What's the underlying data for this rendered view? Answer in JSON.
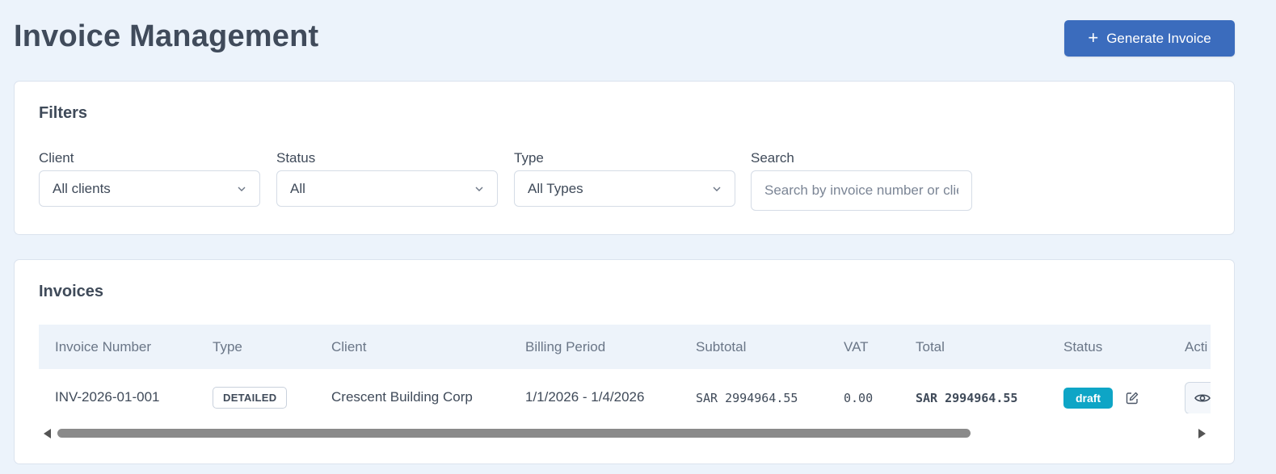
{
  "header": {
    "title": "Invoice Management",
    "generate_button": {
      "icon": "plus-icon",
      "label": "Generate Invoice"
    }
  },
  "filters": {
    "title": "Filters",
    "client": {
      "label": "Client",
      "value": "All clients"
    },
    "status": {
      "label": "Status",
      "value": "All"
    },
    "type": {
      "label": "Type",
      "value": "All Types"
    },
    "search": {
      "label": "Search",
      "placeholder": "Search by invoice number or client"
    }
  },
  "invoices": {
    "title": "Invoices",
    "columns": [
      "Invoice Number",
      "Type",
      "Client",
      "Billing Period",
      "Subtotal",
      "VAT",
      "Total",
      "Status",
      "Acti"
    ],
    "rows": [
      {
        "invoice_number": "INV-2026-01-001",
        "type": "DETAILED",
        "client": "Crescent Building Corp",
        "billing_period": "1/1/2026 - 1/4/2026",
        "subtotal": "SAR 2994964.55",
        "vat": "0.00",
        "total": "SAR 2994964.55",
        "status": "draft"
      }
    ]
  },
  "colors": {
    "primary": "#3b6cbd",
    "status_draft": "#0ea5c6",
    "page_bg": "#ecf3fb"
  }
}
